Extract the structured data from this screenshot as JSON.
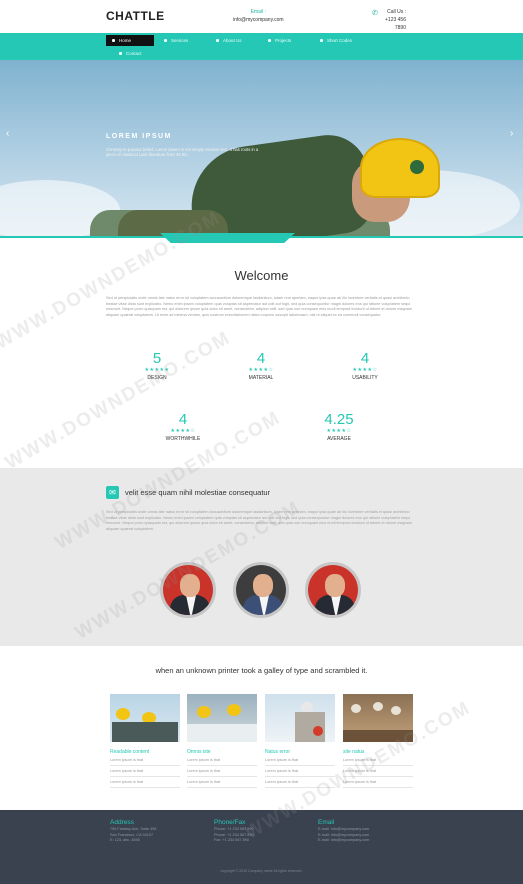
{
  "header": {
    "logo": "CHATTLE",
    "email_label": "Email :",
    "email_value": "info@mycompany.com",
    "call_label": "Call Us :",
    "call_value": "+123 456 7890"
  },
  "nav": [
    {
      "label": "Home",
      "active": true
    },
    {
      "label": "Services",
      "active": false
    },
    {
      "label": "About Us",
      "active": false
    },
    {
      "label": "Projects",
      "active": false
    },
    {
      "label": "Short Codes",
      "active": false
    },
    {
      "label": "Contact",
      "active": false
    }
  ],
  "hero": {
    "title": "LOREM IPSUM",
    "text": "Contrary to popular belief, Lorem Ipsum is not simply random text. It has roots in a piece of classical Latin literature from 45 BC."
  },
  "welcome": {
    "title": "Welcome",
    "text": "Sed ut perspiciatis unde omnis iste natus error sit voluptatem accusantium doloremque laudantium, totam rem aperiam, eaque ipsa quae ab illo inventore veritatis et quasi architecto beatae vitae dicta sunt explicabo. Nemo enim ipsam voluptatem quia voluptas sit aspernatur aut odit aut fugit, sed quia consequuntur magni dolores eos qui ratione voluptatem sequi nesciunt. Neque porro quisquam est, qui dolorem ipsum quia dolor sit amet, consectetur, adipisci velit, sed quia non numquam eius modi tempora incidunt ut labore et dolore magnam aliquam quaerat voluptatem. Ut enim ad minima veniam, quis nostrum exercitationem ullam corporis suscipit laboriosam, nisi ut aliquid ex ea commodi consequatur."
  },
  "stats": [
    {
      "value": "5",
      "stars": "★★★★★",
      "label": "DESIGN"
    },
    {
      "value": "4",
      "stars": "★★★★☆",
      "label": "MATERIAL"
    },
    {
      "value": "4",
      "stars": "★★★★☆",
      "label": "USABILITY"
    },
    {
      "value": "4",
      "stars": "★★★★☆",
      "label": "WORTHWHILE"
    },
    {
      "value": "4.25",
      "stars": "★★★★☆",
      "label": "AVERAGE"
    }
  ],
  "team_section": {
    "icon": "chat-icon",
    "title": "velit esse quam nihil molestiae consequatur",
    "text": "Sed ut perspiciatis unde omnis iste natus error sit voluptatem accusantium doloremque laudantium, totam rem aperiam, eaque ipsa quae ab illo inventore veritatis et quasi architecto beatae vitae dicta sunt explicabo. Nemo enim ipsam voluptatem quia voluptas sit aspernatur aut odit aut fugit, sed quia consequuntur magni dolores eos qui ratione voluptatem sequi nesciunt. Neque porro quisquam est, qui dolorem ipsum quia dolor sit amet, consectetur, adipisci velit, sed quia non numquam eius modi tempora incidunt ut labore et dolore magnam aliquam quaerat voluptatem."
  },
  "gallery": {
    "title": "when an unknown printer took a galley of type and scrambled it.",
    "cards": [
      {
        "title": "Readable content",
        "rows": [
          "Lorem ipsum is that",
          "Lorem ipsum is that",
          "Lorem ipsum is that"
        ]
      },
      {
        "title": "Omnis iste",
        "rows": [
          "Lorem ipsum is that",
          "Lorem ipsum is that",
          "Lorem ipsum is that"
        ]
      },
      {
        "title": "Natus error",
        "rows": [
          "Lorem ipsum is that",
          "Lorem ipsum is that",
          "Lorem ipsum is that"
        ]
      },
      {
        "title": "site natus",
        "rows": [
          "Lorem ipsum is that",
          "Lorem ipsum is that",
          "Lorem ipsum is that"
        ]
      }
    ]
  },
  "footer": {
    "address_title": "Address",
    "address_lines": [
      "756 Fantasy Ave, Suite 408",
      "San Francisco, CA 94107",
      "E: 123, abc, 4556"
    ],
    "phone_title": "Phone/Fax",
    "phone_lines": [
      "Phone: +1 234 567 890",
      "Phone: +1 234 567 890",
      "Fax: +1 234 567 890"
    ],
    "email_title": "Email",
    "email_lines": [
      "E-mail: info@mycompany.com",
      "E-mail: info@mycompany.com",
      "E-mail: info@mycompany.com"
    ],
    "copyright": "copyright © 2015 Company name All rights reserved."
  },
  "watermark": "WWW.DOWNDEMO.COM",
  "colors": {
    "accent": "#25c7b5",
    "footer": "#3a4250",
    "grey": "#e9e9e9"
  }
}
